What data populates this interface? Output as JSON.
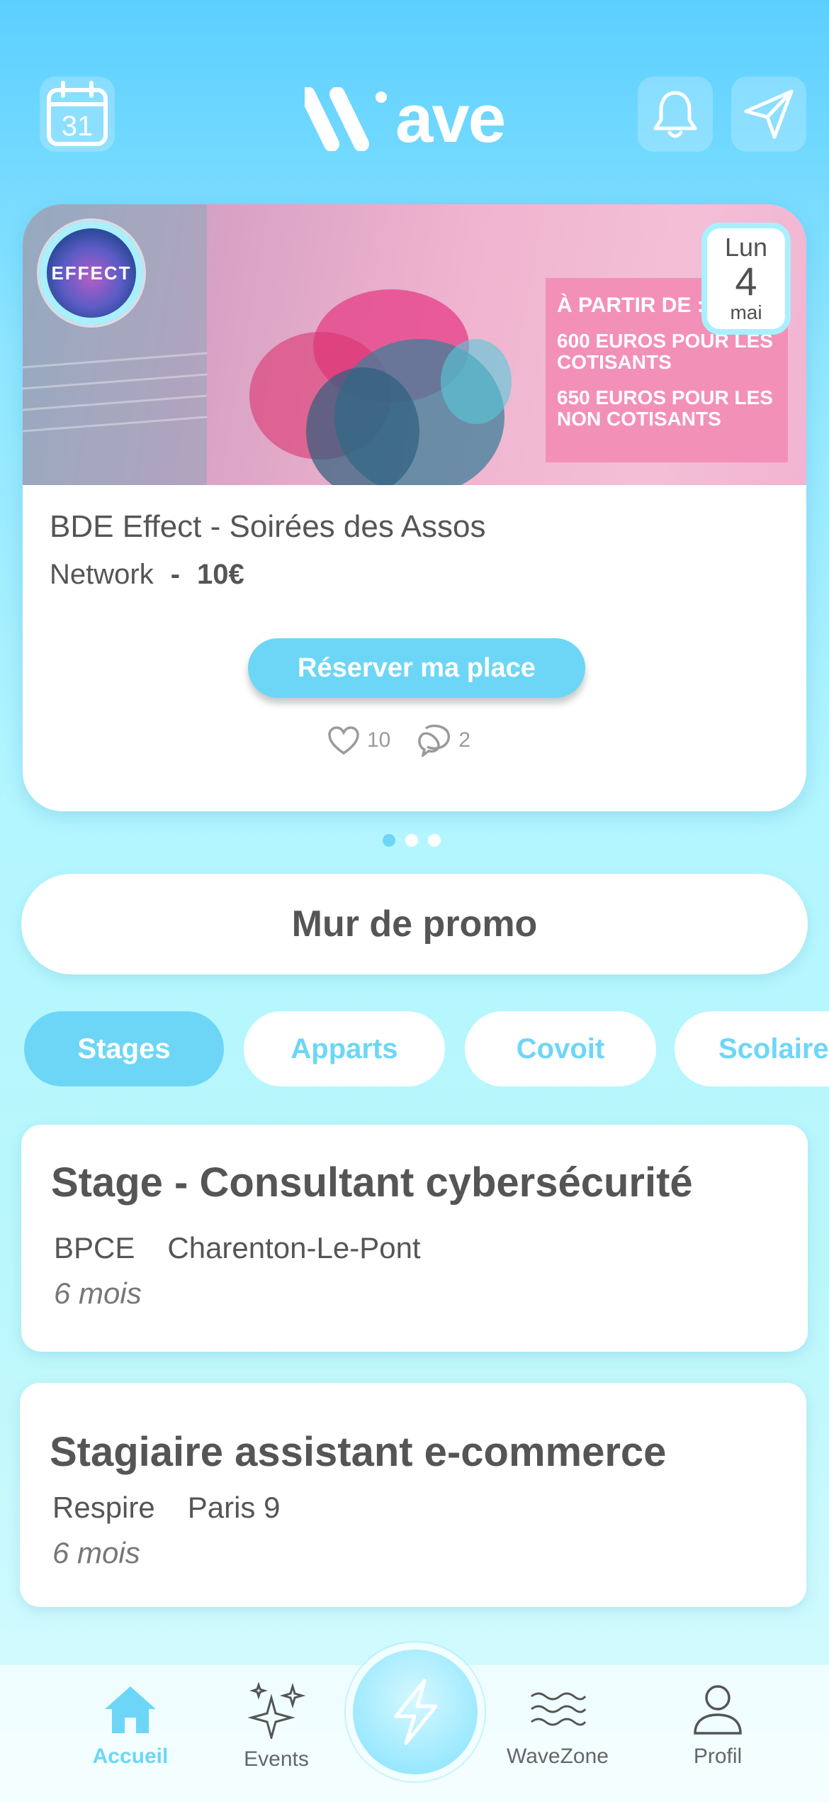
{
  "header": {
    "calendar_day": "31",
    "logo_text": "ave",
    "icons": {
      "calendar": "calendar-icon",
      "notifications": "bell-icon",
      "messages": "send-icon"
    }
  },
  "event_card": {
    "organizer_logo_text": "EFFECT",
    "banner_promo": {
      "line1": "À PARTIR DE :",
      "line2": "600 EUROS POUR LES COTISANTS",
      "line3": "650 EUROS POUR LES NON COTISANTS"
    },
    "date": {
      "weekday": "Lun",
      "day": "4",
      "month": "mai"
    },
    "title": "BDE Effect - Soirées des Assos",
    "category": "Network",
    "separator": "-",
    "price": "10€",
    "reserve_label": "Réserver ma place",
    "likes": "10",
    "comments": "2"
  },
  "carousel": {
    "count": 3,
    "active_index": 0
  },
  "wall_button_label": "Mur de promo",
  "filters": [
    {
      "label": "Stages",
      "active": true
    },
    {
      "label": "Apparts",
      "active": false
    },
    {
      "label": "Covoit",
      "active": false
    },
    {
      "label": "Scolaire",
      "active": false
    }
  ],
  "jobs": [
    {
      "title": "Stage - Consultant cybersécurité",
      "company": "BPCE",
      "location": "Charenton-Le-Pont",
      "duration": "6 mois"
    },
    {
      "title": "Stagiaire assistant e-commerce",
      "company": "Respire",
      "location": "Paris 9",
      "duration": "6 mois"
    }
  ],
  "nav": {
    "items": [
      {
        "label": "Accueil",
        "icon": "home-icon",
        "active": true
      },
      {
        "label": "Events",
        "icon": "sparkles-icon",
        "active": false
      },
      {
        "label": "WaveZone",
        "icon": "waves-icon",
        "active": false
      },
      {
        "label": "Profil",
        "icon": "user-icon",
        "active": false
      }
    ],
    "center_icon": "lightning-icon"
  },
  "colors": {
    "accent": "#6dd6f7",
    "text": "#555555",
    "promo_pink": "#f390b8"
  }
}
